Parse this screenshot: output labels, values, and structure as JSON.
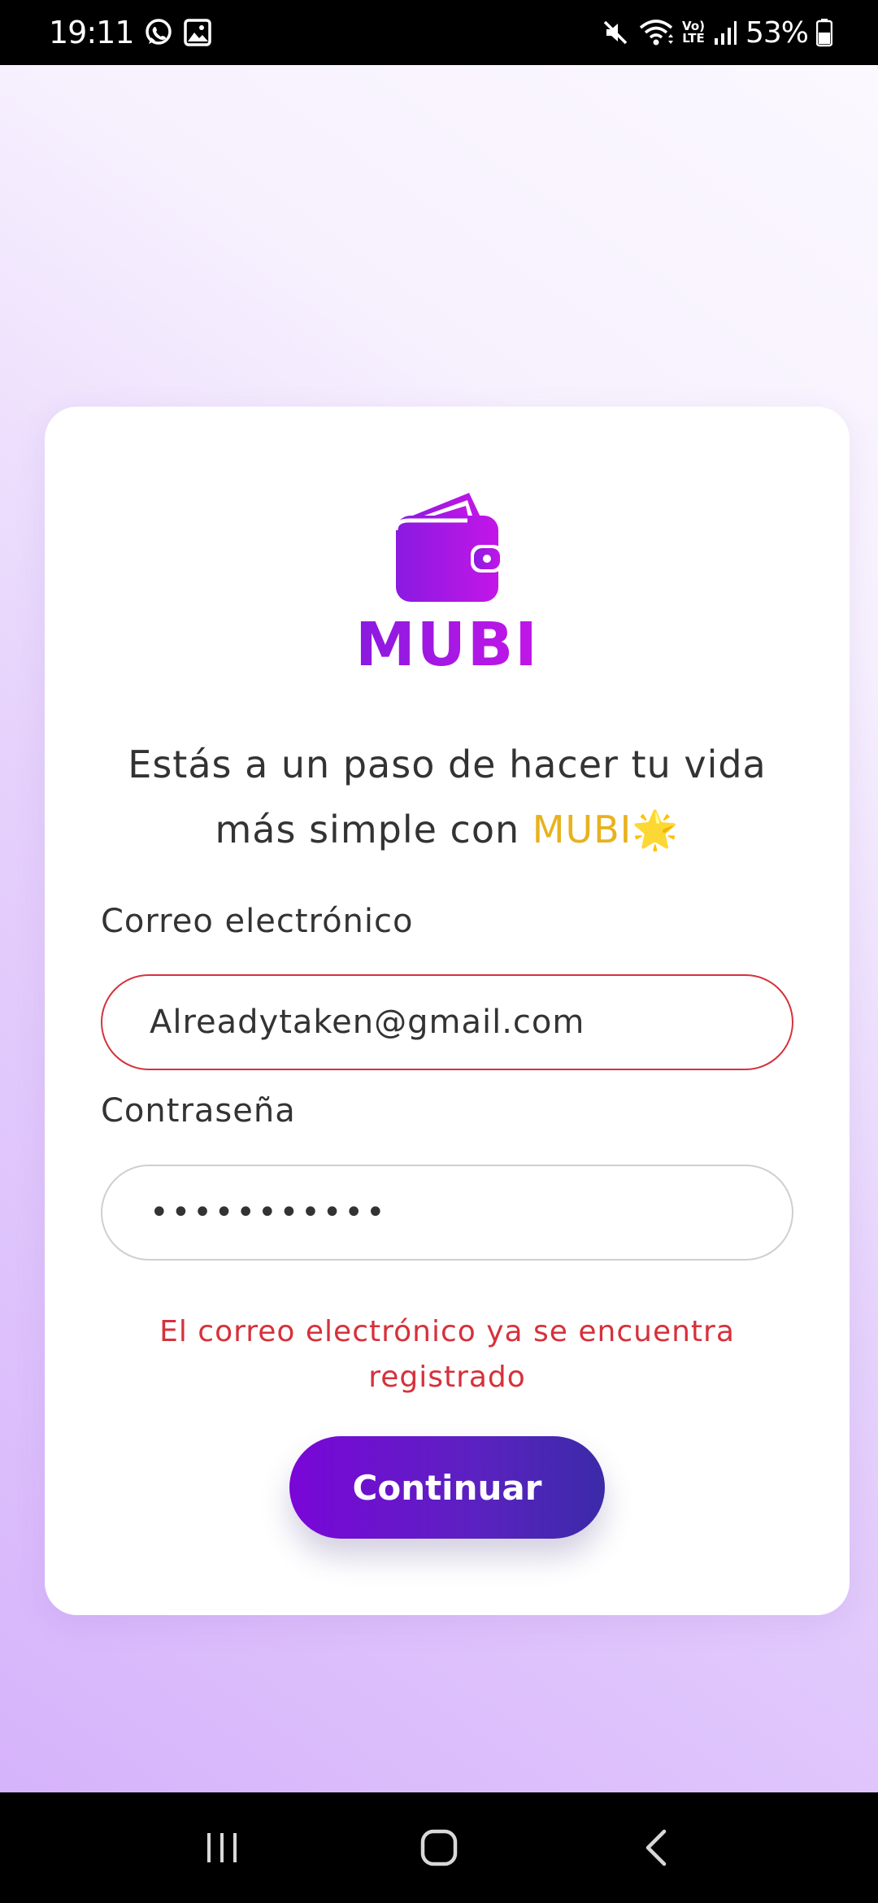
{
  "status_bar": {
    "time": "19:11",
    "network": "Vo) LTE",
    "battery": "53%"
  },
  "logo": {
    "brand": "MUBI",
    "icon": "wallet-icon"
  },
  "tagline": {
    "line1": "Estás a un paso de hacer tu vida",
    "line2_prefix": "más simple con ",
    "brand": "MUBI",
    "emoji": "🌟"
  },
  "form": {
    "email_label": "Correo electrónico",
    "email_value": "Alreadytaken@gmail.com",
    "password_label": "Contraseña",
    "password_value": "•••••••••••",
    "error": "El correo electrónico ya se encuentra registrado",
    "submit_label": "Continuar"
  },
  "colors": {
    "brand_purple": "#9b12e6",
    "error_red": "#d6313b",
    "highlight_yellow": "#e8b21e",
    "button_start": "#7a06d8",
    "button_end": "#3b2aa8"
  },
  "nav_bar": {
    "icons": [
      "recents-icon",
      "home-icon",
      "back-icon"
    ]
  }
}
